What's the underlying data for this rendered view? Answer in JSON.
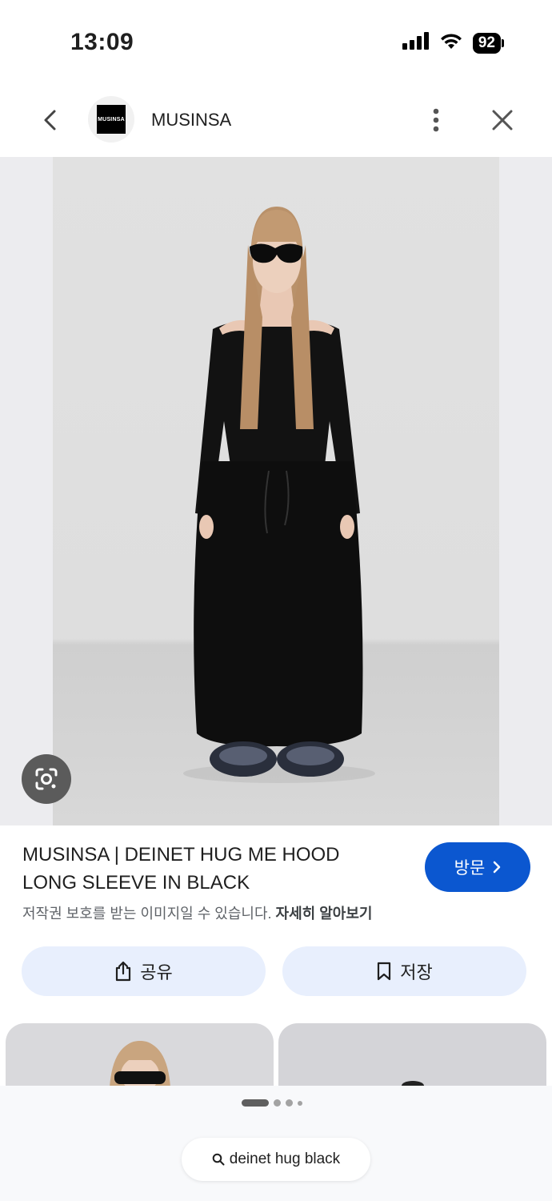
{
  "status_bar": {
    "time": "13:09",
    "battery": "92",
    "icons": [
      "cellular-signal-icon",
      "wifi-icon",
      "battery-icon"
    ]
  },
  "header": {
    "site_name": "MUSINSA",
    "logo_text": "MUSINSA",
    "icons": [
      "back-chevron-icon",
      "more-vertical-icon",
      "close-icon"
    ]
  },
  "image": {
    "icon": "google-lens-icon"
  },
  "result": {
    "title": "MUSINSA | DEINET HUG ME HOOD LONG SLEEVE IN BLACK",
    "visit_label": "방문",
    "copyright_text": "저작권 보호를 받는 이미지일 수 있습니다.",
    "learn_more": "자세히 알아보기"
  },
  "actions": {
    "share_label": "공유",
    "save_label": "저장"
  },
  "bottom": {
    "search_query": "deinet hug black",
    "page_dots": 4,
    "active_dot": 0
  },
  "colors": {
    "accent": "#0b57d0",
    "action_bg": "#e8effd",
    "lens_bg": "#5b5b5b",
    "text_muted": "#5f6368"
  }
}
